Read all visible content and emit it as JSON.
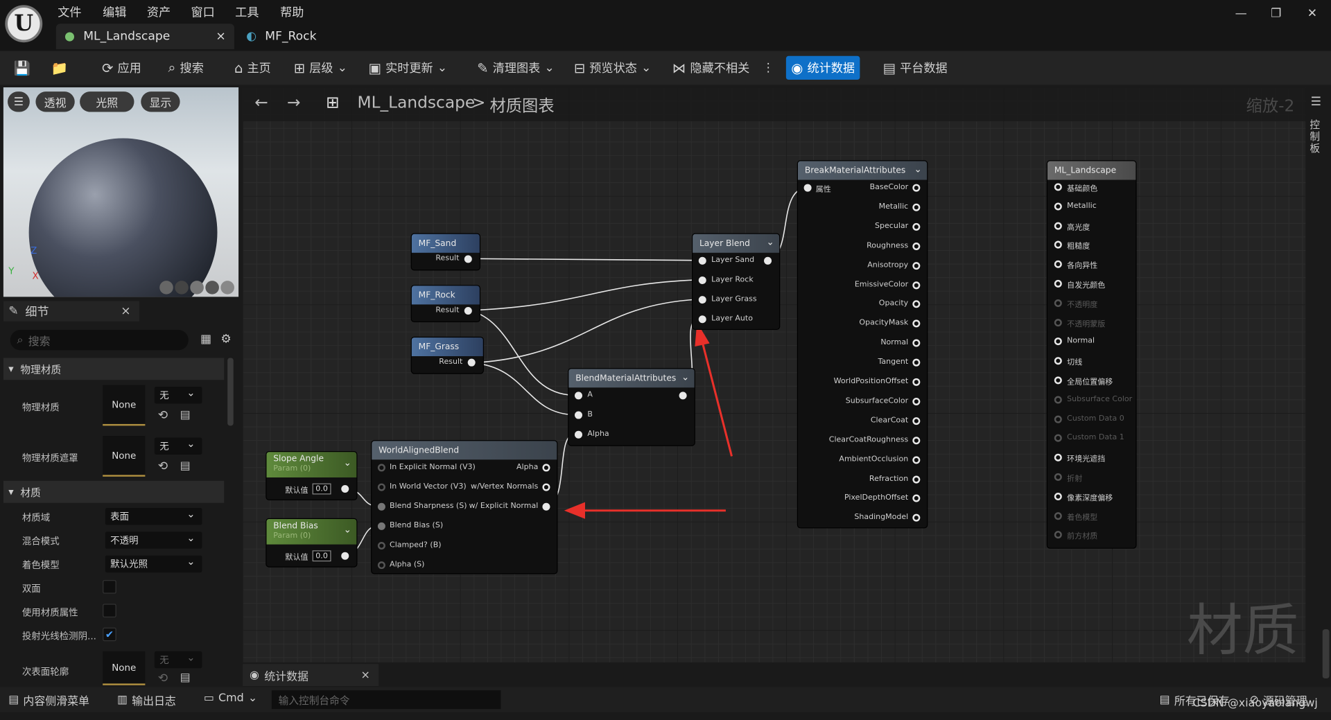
{
  "app": {
    "logo": "U",
    "menus": [
      "文件",
      "编辑",
      "资产",
      "窗口",
      "工具",
      "帮助"
    ],
    "tabs": [
      {
        "label": "ML_Landscape",
        "close": "×"
      },
      {
        "label": "MF_Rock"
      }
    ],
    "window": {
      "minimize": "—",
      "restore": "❐",
      "close": "✕"
    }
  },
  "toolbar": {
    "apply": "应用",
    "search": "搜索",
    "home": "主页",
    "hierarchy": "层级",
    "live_update": "实时更新",
    "clean_graph": "清理图表",
    "preview_state": "预览状态",
    "hide_unrelated": "隐藏不相关",
    "more": "⋮",
    "stats": "统计数据",
    "platform_stats": "平台数据"
  },
  "viewport": {
    "menu": "☰",
    "perspective": "透视",
    "lit": "光照",
    "show": "显示",
    "axis_z": "Z",
    "axis_y": "Y",
    "axis_x": "X"
  },
  "details": {
    "title": "细节",
    "close": "×",
    "search_placeholder": "搜索",
    "section_physical": "物理材质",
    "physical_material": "物理材质",
    "physical_mask": "物理材质遮罩",
    "none": "None",
    "wu": "无",
    "section_material": "材质",
    "rows": [
      {
        "label": "材质域",
        "value": "表面"
      },
      {
        "label": "混合模式",
        "value": "不透明"
      },
      {
        "label": "着色模型",
        "value": "默认光照"
      }
    ],
    "two_sided": "双面",
    "use_attributes": "使用材质属性",
    "cast_ray": "投射光线检测阴...",
    "subsurface": "次表面轮廓"
  },
  "graph": {
    "back": "←",
    "forward": "→",
    "crumb_root": "ML_Landscape",
    "crumb_sep": ">",
    "crumb_child": "材质图表",
    "zoom": "缩放-2",
    "watermark": "材质",
    "side_panel": "控制板"
  },
  "nodes": {
    "mf_sand": {
      "title": "MF_Sand",
      "out": "Result"
    },
    "mf_rock": {
      "title": "MF_Rock",
      "out": "Result"
    },
    "mf_grass": {
      "title": "MF_Grass",
      "out": "Result"
    },
    "layer_blend": {
      "title": "Layer Blend",
      "inputs": [
        "Layer Sand",
        "Layer Rock",
        "Layer Grass",
        "Layer Auto"
      ]
    },
    "blend_attr": {
      "title": "BlendMaterialAttributes",
      "inputs": [
        "A",
        "B",
        "Alpha"
      ]
    },
    "wab": {
      "title": "WorldAlignedBlend",
      "inputs": [
        "In Explicit Normal (V3)",
        "In World Vector (V3)",
        "Blend Sharpness (S)",
        "Blend Bias (S)",
        "Clamped? (B)",
        "Alpha (S)"
      ],
      "outputs": [
        "Alpha",
        "w/Vertex Normals",
        "w/ Explicit Normal"
      ]
    },
    "slope": {
      "title": "Slope Angle",
      "sub": "Param (0)",
      "label": "默认值",
      "value": "0.0"
    },
    "bias": {
      "title": "Blend Bias",
      "sub": "Param (0)",
      "label": "默认值",
      "value": "0.0"
    },
    "break": {
      "title": "BreakMaterialAttributes",
      "input": "属性",
      "outputs": [
        "BaseColor",
        "Metallic",
        "Specular",
        "Roughness",
        "Anisotropy",
        "EmissiveColor",
        "Opacity",
        "OpacityMask",
        "Normal",
        "Tangent",
        "WorldPositionOffset",
        "SubsurfaceColor",
        "ClearCoat",
        "ClearCoatRoughness",
        "AmbientOcclusion",
        "Refraction",
        "PixelDepthOffset",
        "ShadingModel"
      ]
    },
    "result": {
      "title": "ML_Landscape",
      "inputs": [
        "基础颜色",
        "Metallic",
        "高光度",
        "粗糙度",
        "各向异性",
        "自发光颜色",
        "不透明度",
        "不透明蒙版",
        "Normal",
        "切线",
        "全局位置偏移",
        "Subsurface Color",
        "Custom Data 0",
        "Custom Data 1",
        "环境光遮挡",
        "折射",
        "像素深度偏移",
        "着色模型",
        "前方材质"
      ],
      "dim": [
        6,
        7,
        11,
        12,
        13,
        15,
        17,
        18
      ]
    }
  },
  "bottom": {
    "stats_tab": "统计数据",
    "content_drawer": "内容侧滑菜单",
    "output_log": "输出日志",
    "cmd": "Cmd",
    "console_placeholder": "输入控制台命令",
    "all_saved": "所有已保存",
    "source_control": "源码管理",
    "watermark": "CSDN @xiaoyaolangwj"
  },
  "colors": {
    "accent": "#0e70c8",
    "arrow": "#e8302a",
    "param": "#5f8a3c"
  }
}
